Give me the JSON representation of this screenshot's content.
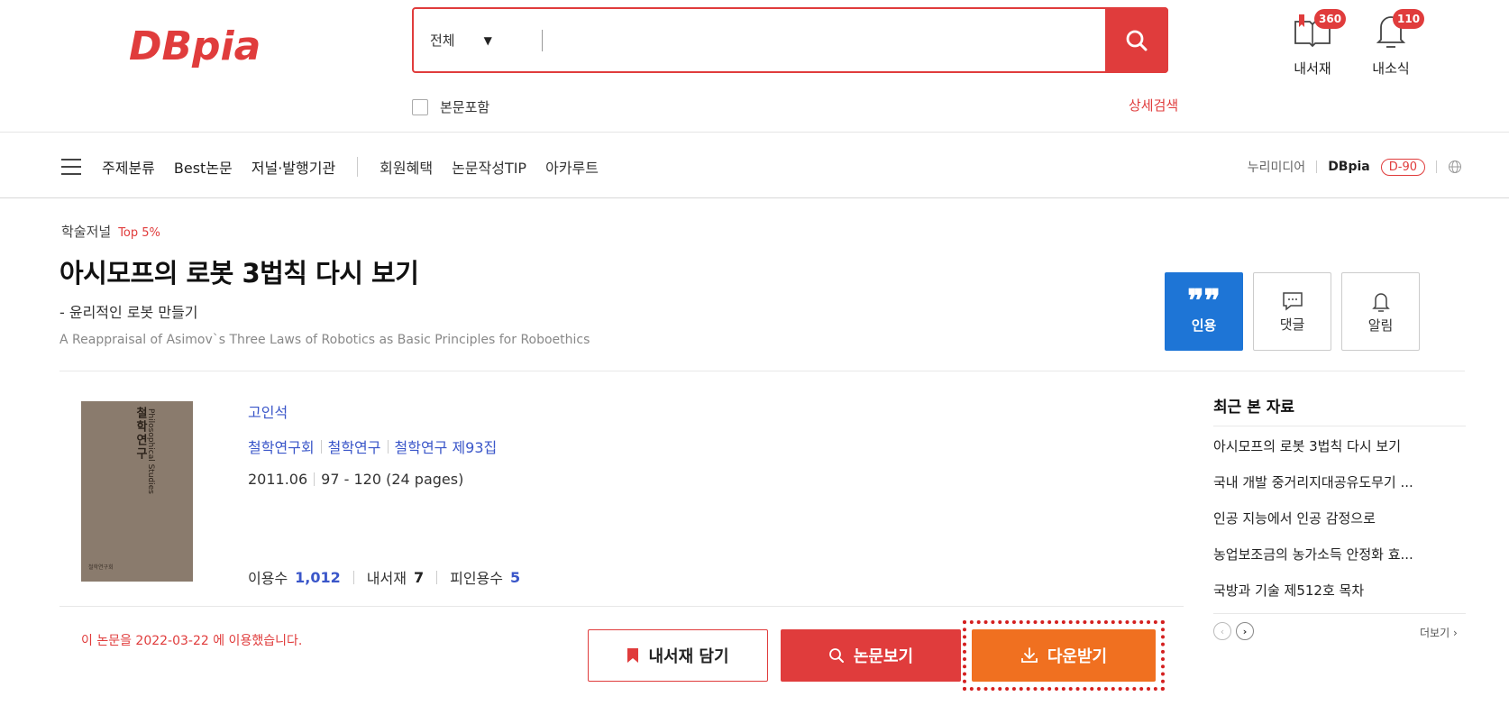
{
  "header": {
    "logo_text": "DBpia",
    "search_scope": "전체",
    "search_placeholder": "",
    "fulltext_label": "본문포함",
    "advanced_search": "상세검색",
    "bookshelf": {
      "label": "내서재",
      "count": "360"
    },
    "notifications": {
      "label": "내소식",
      "count": "110"
    }
  },
  "nav": {
    "items": [
      "주제분류",
      "Best논문",
      "저널·발행기관",
      "회원혜택",
      "논문작성TIP",
      "아카루트"
    ],
    "right": {
      "company": "누리미디어",
      "brand": "DBpia",
      "dday": "D-90"
    }
  },
  "article": {
    "category": "학술저널",
    "rank": "Top 5%",
    "title": "아시모프의 로봇 3법칙 다시 보기",
    "subtitle": "- 윤리적인 로봇 만들기",
    "english_title": "A Reappraisal of Asimov`s Three Laws of Robotics as Basic Principles for Roboethics",
    "author": "고인석",
    "publisher": "철학연구회",
    "journal": "철학연구",
    "issue": "철학연구 제93집",
    "date": "2011.06",
    "pages": "97 - 120 (24 pages)",
    "stats": {
      "usage_label": "이용수",
      "usage_value": "1,012",
      "shelf_label": "내서재",
      "shelf_value": "7",
      "cited_label": "피인용수",
      "cited_value": "5"
    },
    "used_note": "이 논문을 2022-03-22 에 이용했습니다.",
    "cover": {
      "title": "철학연구",
      "subtitle": "Philosophical Studies"
    }
  },
  "actions": {
    "cite": "인용",
    "comment": "댓글",
    "alert": "알림",
    "add_shelf": "내서재 담기",
    "view": "논문보기",
    "download": "다운받기"
  },
  "sidebar": {
    "title": "최근 본 자료",
    "recent": [
      "아시모프의 로봇 3법칙 다시 보기",
      "국내 개발 중거리지대공유도무기 ...",
      "인공 지능에서 인공 감정으로",
      "농업보조금의 농가소득 안정화 효...",
      "국방과 기술 제512호 목차"
    ],
    "more": "더보기"
  },
  "colors": {
    "brand_red": "#e03c3c",
    "cite_blue": "#1e75d6",
    "download_orange": "#f07020",
    "link_blue": "#3a56c9"
  }
}
